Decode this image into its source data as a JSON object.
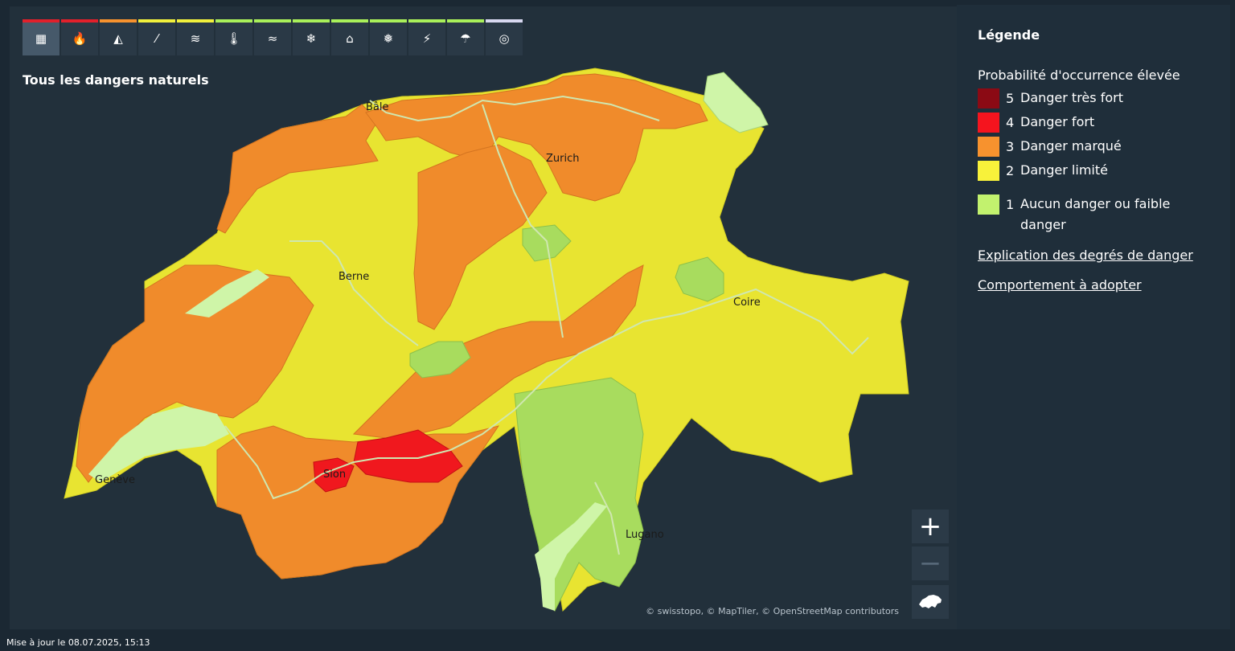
{
  "map": {
    "title": "Tous les dangers naturels",
    "attribution": "© swisstopo, © MapTiler, © OpenStreetMap contributors",
    "cities": [
      "Bâle",
      "Zurich",
      "Berne",
      "Coire",
      "Genève",
      "Sion",
      "Lugano"
    ],
    "toolbar": [
      {
        "icon": "all-hazards-grid-icon",
        "glyph": "▦",
        "level_color": "#e2202b",
        "active": true
      },
      {
        "icon": "forest-fire-icon",
        "glyph": "🔥",
        "level_color": "#e2202b",
        "active": false
      },
      {
        "icon": "avalanche-icon",
        "glyph": "◭",
        "level_color": "#f7922e",
        "active": false
      },
      {
        "icon": "landslide-icon",
        "glyph": "⁄",
        "level_color": "#f1f03c",
        "active": false
      },
      {
        "icon": "flood-icon",
        "glyph": "≋",
        "level_color": "#f1f03c",
        "active": false
      },
      {
        "icon": "heat-icon",
        "glyph": "🌡",
        "level_color": "#a9f05a",
        "active": false
      },
      {
        "icon": "wind-icon",
        "glyph": "≈",
        "level_color": "#a9f05a",
        "active": false
      },
      {
        "icon": "snow-icon",
        "glyph": "❄",
        "level_color": "#a9f05a",
        "active": false
      },
      {
        "icon": "black-ice-house-icon",
        "glyph": "⌂",
        "level_color": "#a9f05a",
        "active": false
      },
      {
        "icon": "frost-icon",
        "glyph": "❅",
        "level_color": "#a9f05a",
        "active": false
      },
      {
        "icon": "thunderstorm-icon",
        "glyph": "⚡",
        "level_color": "#a9f05a",
        "active": false
      },
      {
        "icon": "rain-icon",
        "glyph": "☂",
        "level_color": "#a9f05a",
        "active": false
      },
      {
        "icon": "earthquake-icon",
        "glyph": "◎",
        "level_color": "#d8d8f0",
        "active": false
      }
    ],
    "zoom_in_label": "+",
    "zoom_out_label": "−",
    "reset_icon": "switzerland-reset-icon"
  },
  "legend": {
    "title": "Légende",
    "subtitle": "Probabilité d'occurrence élevée",
    "levels": [
      {
        "level": "5",
        "label": "Danger très fort",
        "color": "#8b0a14"
      },
      {
        "level": "4",
        "label": "Danger fort",
        "color": "#f5141e"
      },
      {
        "level": "3",
        "label": "Danger marqué",
        "color": "#f7922e"
      },
      {
        "level": "2",
        "label": "Danger limité",
        "color": "#f8f23a"
      },
      {
        "level": "1",
        "label": "Aucun danger ou faible danger",
        "color": "#c2f26e"
      }
    ],
    "links": [
      "Explication des degrés de danger",
      "Comportement à adopter"
    ]
  },
  "footer": {
    "updated": "Mise à jour le 08.07.2025, 15:13"
  }
}
